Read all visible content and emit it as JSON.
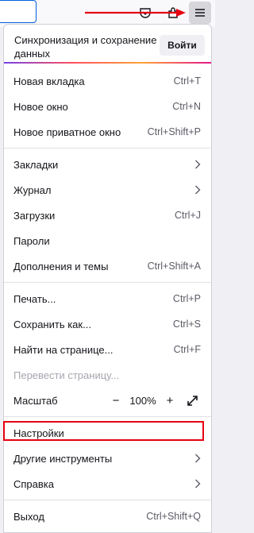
{
  "menu": {
    "sync_title": "Синхронизация и сохранение данных",
    "signin_label": "Войти",
    "new_tab": {
      "label": "Новая вкладка",
      "shortcut": "Ctrl+T"
    },
    "new_window": {
      "label": "Новое окно",
      "shortcut": "Ctrl+N"
    },
    "new_private": {
      "label": "Новое приватное окно",
      "shortcut": "Ctrl+Shift+P"
    },
    "bookmarks": {
      "label": "Закладки"
    },
    "history": {
      "label": "Журнал"
    },
    "downloads": {
      "label": "Загрузки",
      "shortcut": "Ctrl+J"
    },
    "passwords": {
      "label": "Пароли"
    },
    "addons": {
      "label": "Дополнения и темы",
      "shortcut": "Ctrl+Shift+A"
    },
    "print": {
      "label": "Печать...",
      "shortcut": "Ctrl+P"
    },
    "save_as": {
      "label": "Сохранить как...",
      "shortcut": "Ctrl+S"
    },
    "find": {
      "label": "Найти на странице...",
      "shortcut": "Ctrl+F"
    },
    "translate": {
      "label": "Перевести страницу..."
    },
    "zoom": {
      "label": "Масштаб",
      "minus": "−",
      "value": "100%",
      "plus": "+"
    },
    "settings": {
      "label": "Настройки"
    },
    "more_tools": {
      "label": "Другие инструменты"
    },
    "help": {
      "label": "Справка"
    },
    "exit": {
      "label": "Выход",
      "shortcut": "Ctrl+Shift+Q"
    }
  },
  "colors": {
    "highlight": "#e60012",
    "accent": "#0060df"
  },
  "icons": [
    "pocket-icon",
    "extensions-icon",
    "hamburger-menu-icon",
    "chevron-right-icon",
    "fullscreen-icon"
  ]
}
